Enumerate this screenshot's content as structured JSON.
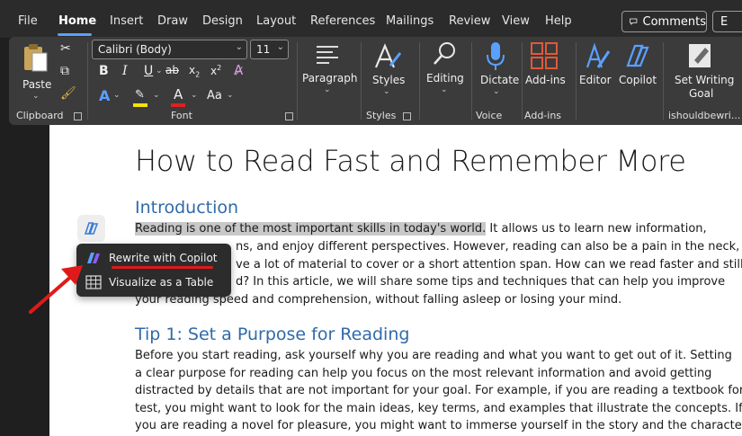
{
  "menu": {
    "items": [
      "File",
      "Home",
      "Insert",
      "Draw",
      "Design",
      "Layout",
      "References",
      "Mailings",
      "Review",
      "View",
      "Help"
    ],
    "active": "Home",
    "comments_label": "Comments",
    "edit_label": "E"
  },
  "ribbon": {
    "clipboard": {
      "paste_label": "Paste",
      "group_label": "Clipboard"
    },
    "font": {
      "font_name": "Calibri (Body)",
      "font_size": "11",
      "group_label": "Font",
      "change_case_label": "Aa"
    },
    "paragraph": {
      "label": "Paragraph"
    },
    "styles": {
      "label": "Styles",
      "group_label": "Styles"
    },
    "editing": {
      "label": "Editing"
    },
    "voice": {
      "dictate_label": "Dictate",
      "group_label": "Voice"
    },
    "addins": {
      "label": "Add-ins",
      "group_label": "Add-ins"
    },
    "editor": {
      "label": "Editor"
    },
    "copilot": {
      "label": "Copilot"
    },
    "writing_goal": {
      "label_line1": "Set Writing",
      "label_line2": "Goal",
      "group_label": "ishouldbewri..."
    }
  },
  "document": {
    "title": "How to Read Fast and Remember More",
    "intro_heading": "Introduction",
    "intro_highlight": "Reading is one of the most important skills in today's world.",
    "intro_line1_rest": " It allows us to learn new information,",
    "intro_line2": "ns, and enjoy different perspectives. However, reading can also be a pain in the neck,",
    "intro_line3": "ve a lot of material to cover or a short attention span. How can we read faster and still",
    "intro_line4": "d? In this article, we will share some tips and techniques that can help you improve",
    "intro_line5": "your reading speed and comprehension, without falling asleep or losing your mind.",
    "tip1_heading": "Tip 1: Set a Purpose for Reading",
    "tip1_lines": [
      "Before you start reading, ask yourself why you are reading and what you want to get out of it. Setting",
      "a clear purpose for reading can help you focus on the most relevant information and avoid getting",
      "distracted by details that are not important for your goal. For example, if you are reading a textbook for a",
      "test, you might want to look for the main ideas, key terms, and examples that illustrate the concepts. If",
      "you are reading a novel for pleasure, you might want to immerse yourself in the story and the characters."
    ]
  },
  "context_menu": {
    "items": [
      {
        "label": "Rewrite with Copilot",
        "icon": "copilot-icon"
      },
      {
        "label": "Visualize as a Table",
        "icon": "table-icon"
      }
    ]
  },
  "colors": {
    "accent": "#5aa0ff",
    "heading": "#2f6aaa",
    "annotation": "#e01a1a",
    "highlight": "#c8c8c8"
  }
}
